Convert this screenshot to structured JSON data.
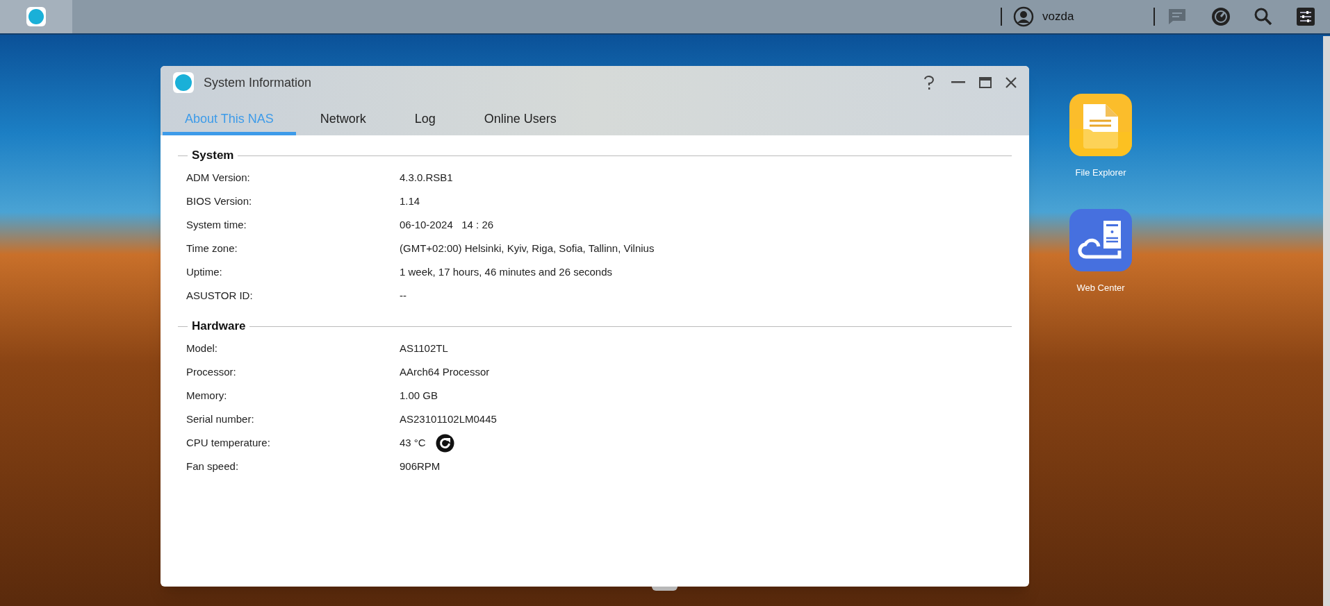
{
  "top_bar": {
    "user": "vozda"
  },
  "window": {
    "title": "System Information",
    "tabs": [
      {
        "label": "About This NAS",
        "selected": true
      },
      {
        "label": "Network",
        "selected": false
      },
      {
        "label": "Log",
        "selected": false
      },
      {
        "label": "Online Users",
        "selected": false
      }
    ],
    "sections": [
      {
        "title": "System",
        "rows": [
          {
            "label": "ADM Version:",
            "value": "4.3.0.RSB1"
          },
          {
            "label": "BIOS Version:",
            "value": "1.14"
          },
          {
            "label": "System time:",
            "value": "06-10-2024   14 : 26"
          },
          {
            "label": "Time zone:",
            "value": "(GMT+02:00) Helsinki, Kyiv, Riga, Sofia, Tallinn, Vilnius"
          },
          {
            "label": "Uptime:",
            "value": "1 week, 17 hours, 46 minutes and 26 seconds"
          },
          {
            "label": "ASUSTOR ID:",
            "value": "--"
          }
        ]
      },
      {
        "title": "Hardware",
        "rows": [
          {
            "label": "Model:",
            "value": "AS1102TL"
          },
          {
            "label": "Processor:",
            "value": "AArch64 Processor"
          },
          {
            "label": "Memory:",
            "value": "1.00 GB"
          },
          {
            "label": "Serial number:",
            "value": "AS23101102LM0445"
          },
          {
            "label": "CPU temperature:",
            "value": "43 °C",
            "kind": "refresh"
          },
          {
            "label": "Fan speed:",
            "value": "906RPM"
          }
        ]
      }
    ]
  },
  "desktop_icons": [
    {
      "label": "File Explorer",
      "kind": "files"
    },
    {
      "label": "Web Center",
      "kind": "web"
    }
  ]
}
